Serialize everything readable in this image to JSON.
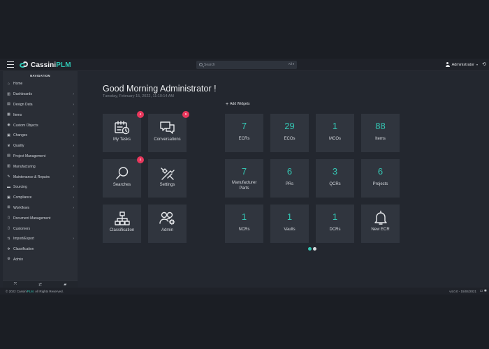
{
  "app": {
    "logo_prefix": "Cassini",
    "logo_accent": "PLM",
    "accent_color": "#34c7b4",
    "badge_color": "#e8375c"
  },
  "search": {
    "placeholder": "Search",
    "scope": "All"
  },
  "user": {
    "name": "Administrator"
  },
  "sidebar": {
    "title": "NAVIGATION",
    "items": [
      {
        "label": "Home",
        "icon": "home-icon",
        "chevron": false
      },
      {
        "label": "Dashboards",
        "icon": "dashboard-icon",
        "chevron": true
      },
      {
        "label": "Design Data",
        "icon": "design-icon",
        "chevron": true
      },
      {
        "label": "Items",
        "icon": "items-icon",
        "chevron": true
      },
      {
        "label": "Custom Objects",
        "icon": "custom-objects-icon",
        "chevron": true
      },
      {
        "label": "Changes",
        "icon": "changes-icon",
        "chevron": true
      },
      {
        "label": "Quality",
        "icon": "quality-icon",
        "chevron": true
      },
      {
        "label": "Project Management",
        "icon": "project-icon",
        "chevron": true
      },
      {
        "label": "Manufacturing",
        "icon": "manufacturing-icon",
        "chevron": true
      },
      {
        "label": "Maintenance & Repairs",
        "icon": "wrench-icon",
        "chevron": true
      },
      {
        "label": "Sourcing",
        "icon": "sourcing-icon",
        "chevron": true
      },
      {
        "label": "Compliance",
        "icon": "compliance-icon",
        "chevron": true
      },
      {
        "label": "Workflows",
        "icon": "workflow-icon",
        "chevron": true
      },
      {
        "label": "Document Management",
        "icon": "document-icon",
        "chevron": false
      },
      {
        "label": "Customers",
        "icon": "customers-icon",
        "chevron": false
      },
      {
        "label": "Import/Export",
        "icon": "import-export-icon",
        "chevron": true
      },
      {
        "label": "Classification",
        "icon": "classification-icon",
        "chevron": false
      },
      {
        "label": "Admin",
        "icon": "admin-icon",
        "chevron": false
      }
    ]
  },
  "main": {
    "greeting": "Good Morning Administrator !",
    "date": "Tuesday, February 15, 2022, 11:10:14 AM",
    "add_widgets": "Add Widgets",
    "quick_tiles": [
      {
        "label": "My Tasks",
        "icon": "tasks-icon",
        "badge": "4"
      },
      {
        "label": "Conversations",
        "icon": "conversations-icon",
        "badge": "9"
      },
      {
        "label": "Searches",
        "icon": "search-icon",
        "badge": "4"
      },
      {
        "label": "Settings",
        "icon": "settings-icon",
        "badge": ""
      },
      {
        "label": "Classification",
        "icon": "classification-icon",
        "badge": ""
      },
      {
        "label": "Admin",
        "icon": "admin-icon",
        "badge": ""
      }
    ],
    "stats": [
      {
        "value": "7",
        "label": "ECRs"
      },
      {
        "value": "29",
        "label": "ECOs"
      },
      {
        "value": "1",
        "label": "MCOs"
      },
      {
        "value": "88",
        "label": "Items"
      },
      {
        "value": "7",
        "label": "Manufacturer Parts"
      },
      {
        "value": "6",
        "label": "PRs"
      },
      {
        "value": "3",
        "label": "QCRs"
      },
      {
        "value": "6",
        "label": "Projects"
      },
      {
        "value": "1",
        "label": "NCRs"
      },
      {
        "value": "1",
        "label": "Vaults"
      },
      {
        "value": "1",
        "label": "DCRs"
      }
    ],
    "new_ecr": {
      "label": "New ECR",
      "icon": "bell-icon"
    },
    "pager": {
      "pages": 2,
      "active": 1
    }
  },
  "footer": {
    "copyright_prefix": "© 2022 Cassini",
    "copyright_accent": "PLM",
    "copyright_suffix": ". All Rights Reserved.",
    "version": "v4.0.0 - 15/04/2021"
  }
}
